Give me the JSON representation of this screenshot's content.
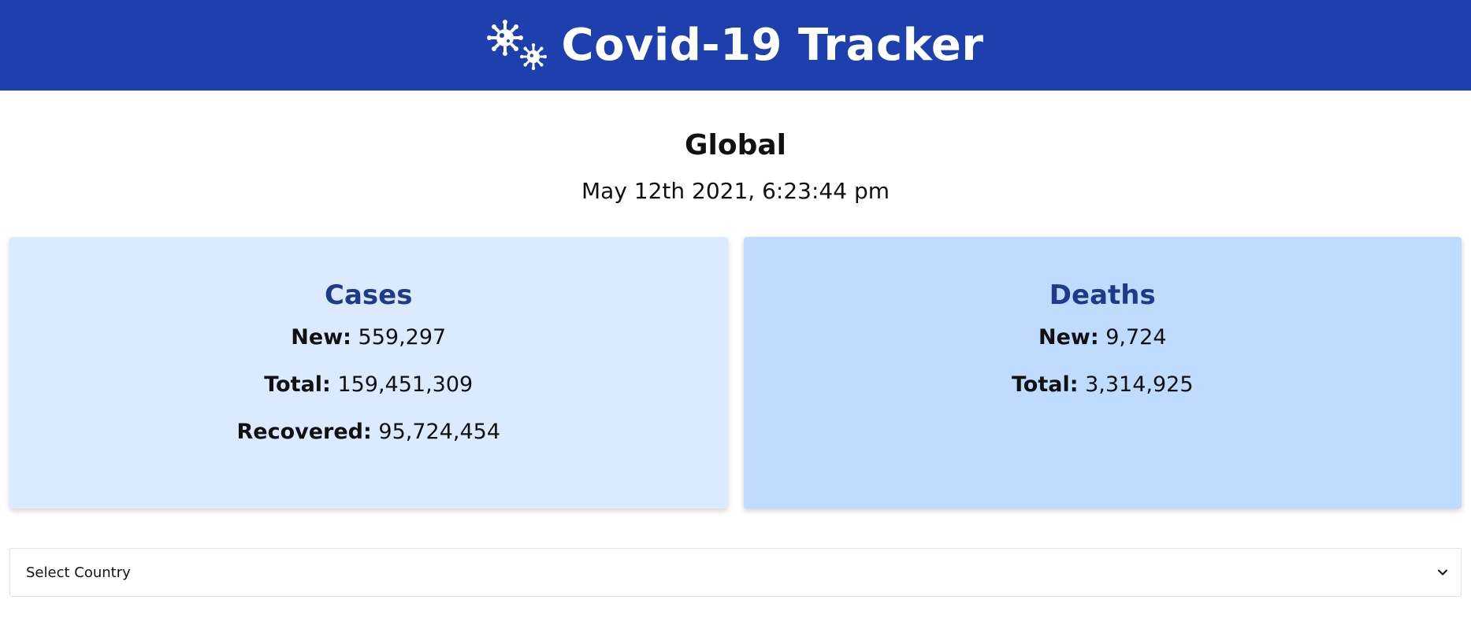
{
  "header": {
    "title": "Covid-19 Tracker",
    "icon": "virus-icon",
    "background": "#1e40af"
  },
  "region": {
    "title": "Global",
    "timestamp": "May 12th 2021, 6:23:44 pm"
  },
  "cases": {
    "title": "Cases",
    "new_label": "New:",
    "new_value": "559,297",
    "total_label": "Total:",
    "total_value": "159,451,309",
    "recovered_label": "Recovered:",
    "recovered_value": "95,724,454",
    "background": "#dbeafe"
  },
  "deaths": {
    "title": "Deaths",
    "new_label": "New:",
    "new_value": "9,724",
    "total_label": "Total:",
    "total_value": "3,314,925",
    "background": "#bfdbfe"
  },
  "country_select": {
    "selected": "Select Country",
    "icon": "chevron-down-icon"
  }
}
